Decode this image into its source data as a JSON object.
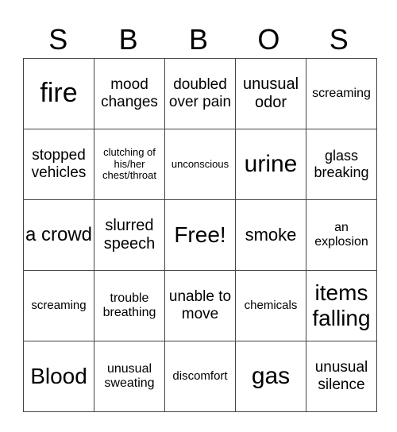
{
  "header": [
    "S",
    "B",
    "B",
    "O",
    "S"
  ],
  "rows": [
    [
      {
        "text": "fire",
        "size": "s34"
      },
      {
        "text": "mood changes",
        "size": "s19"
      },
      {
        "text": "doubled over pain",
        "size": "s19"
      },
      {
        "text": "unusual odor",
        "size": "s20"
      },
      {
        "text": "screaming",
        "size": "s16"
      }
    ],
    [
      {
        "text": "stopped vehicles",
        "size": "s19"
      },
      {
        "text": "clutching of his/her chest/throat",
        "size": "s13"
      },
      {
        "text": "unconscious",
        "size": "s13"
      },
      {
        "text": "urine",
        "size": "s30"
      },
      {
        "text": "glass breaking",
        "size": "s18"
      }
    ],
    [
      {
        "text": "a crowd",
        "size": "s24"
      },
      {
        "text": "slurred speech",
        "size": "s20"
      },
      {
        "text": "Free!",
        "size": "s28"
      },
      {
        "text": "smoke",
        "size": "s22"
      },
      {
        "text": "an explosion",
        "size": "s16"
      }
    ],
    [
      {
        "text": "screaming",
        "size": "s15"
      },
      {
        "text": "trouble breathing",
        "size": "s16"
      },
      {
        "text": "unable to move",
        "size": "s19"
      },
      {
        "text": "chemicals",
        "size": "s15"
      },
      {
        "text": "items falling",
        "size": "s28"
      }
    ],
    [
      {
        "text": "Blood",
        "size": "s28"
      },
      {
        "text": "unusual sweating",
        "size": "s16"
      },
      {
        "text": "discomfort",
        "size": "s15"
      },
      {
        "text": "gas",
        "size": "s30"
      },
      {
        "text": "unusual silence",
        "size": "s19"
      }
    ]
  ]
}
